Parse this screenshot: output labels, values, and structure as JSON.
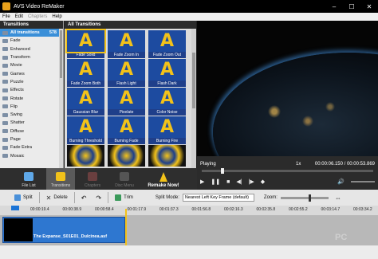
{
  "window": {
    "title": "AVS Video ReMaker",
    "buttons": {
      "minimize": "–",
      "maximize": "☐",
      "close": "✕"
    }
  },
  "menu": [
    "File",
    "Edit",
    "Chapters",
    "Help"
  ],
  "categories": {
    "header": "Transitions",
    "items": [
      {
        "label": "All transitions",
        "count": "578"
      },
      {
        "label": "Fade"
      },
      {
        "label": "Enhanced"
      },
      {
        "label": "Transform"
      },
      {
        "label": "Movie"
      },
      {
        "label": "Games"
      },
      {
        "label": "Puzzle"
      },
      {
        "label": "Effects"
      },
      {
        "label": "Rotate"
      },
      {
        "label": "Flip"
      },
      {
        "label": "Swing"
      },
      {
        "label": "Shatter"
      },
      {
        "label": "Diffuse"
      },
      {
        "label": "Page"
      },
      {
        "label": "Fade Extra"
      },
      {
        "label": "Mosaic"
      }
    ]
  },
  "transitions": {
    "header": "All Transitions",
    "items": [
      {
        "label": "Fade Solid"
      },
      {
        "label": "Fade Zoom In"
      },
      {
        "label": "Fade Zoom Out"
      },
      {
        "label": "Fade Zoom Both"
      },
      {
        "label": "Flash Light"
      },
      {
        "label": "Flash Dark"
      },
      {
        "label": "Gaussian Blur"
      },
      {
        "label": "Pixelate"
      },
      {
        "label": "Color Noise"
      },
      {
        "label": "Burning Threshold"
      },
      {
        "label": "Burning Fade"
      },
      {
        "label": "Burning Fire"
      },
      {
        "label": ""
      },
      {
        "label": ""
      },
      {
        "label": ""
      }
    ]
  },
  "player": {
    "status": "Playing",
    "speed": "1x",
    "time": "00:00:06.150 / 00:00:53.869"
  },
  "toolbar": {
    "file_list": "File List",
    "transitions": "Transitions",
    "chapters": "Chapters",
    "disc_menu": "Disc Menu",
    "remake": "Remake Now!"
  },
  "editbar": {
    "split": "Split",
    "delete": "Delete",
    "trim": "Trim",
    "split_mode_label": "Split Mode:",
    "split_mode_value": "Nearest Left Key Frame (default)",
    "zoom_label": "Zoom:"
  },
  "timeline": {
    "ticks": [
      "00:00:19.4",
      "00:00:38.9",
      "00:00:58.4",
      "00:01:17.9",
      "00:01:37.3",
      "00:01:56.8",
      "00:02:16.3",
      "00:02:35.8",
      "00:02:55.2",
      "00:03:14.7",
      "00:03:34.2"
    ],
    "clip_name": "The Expanse_S01E01_Dulcinea.asf"
  },
  "watermark": "PC"
}
